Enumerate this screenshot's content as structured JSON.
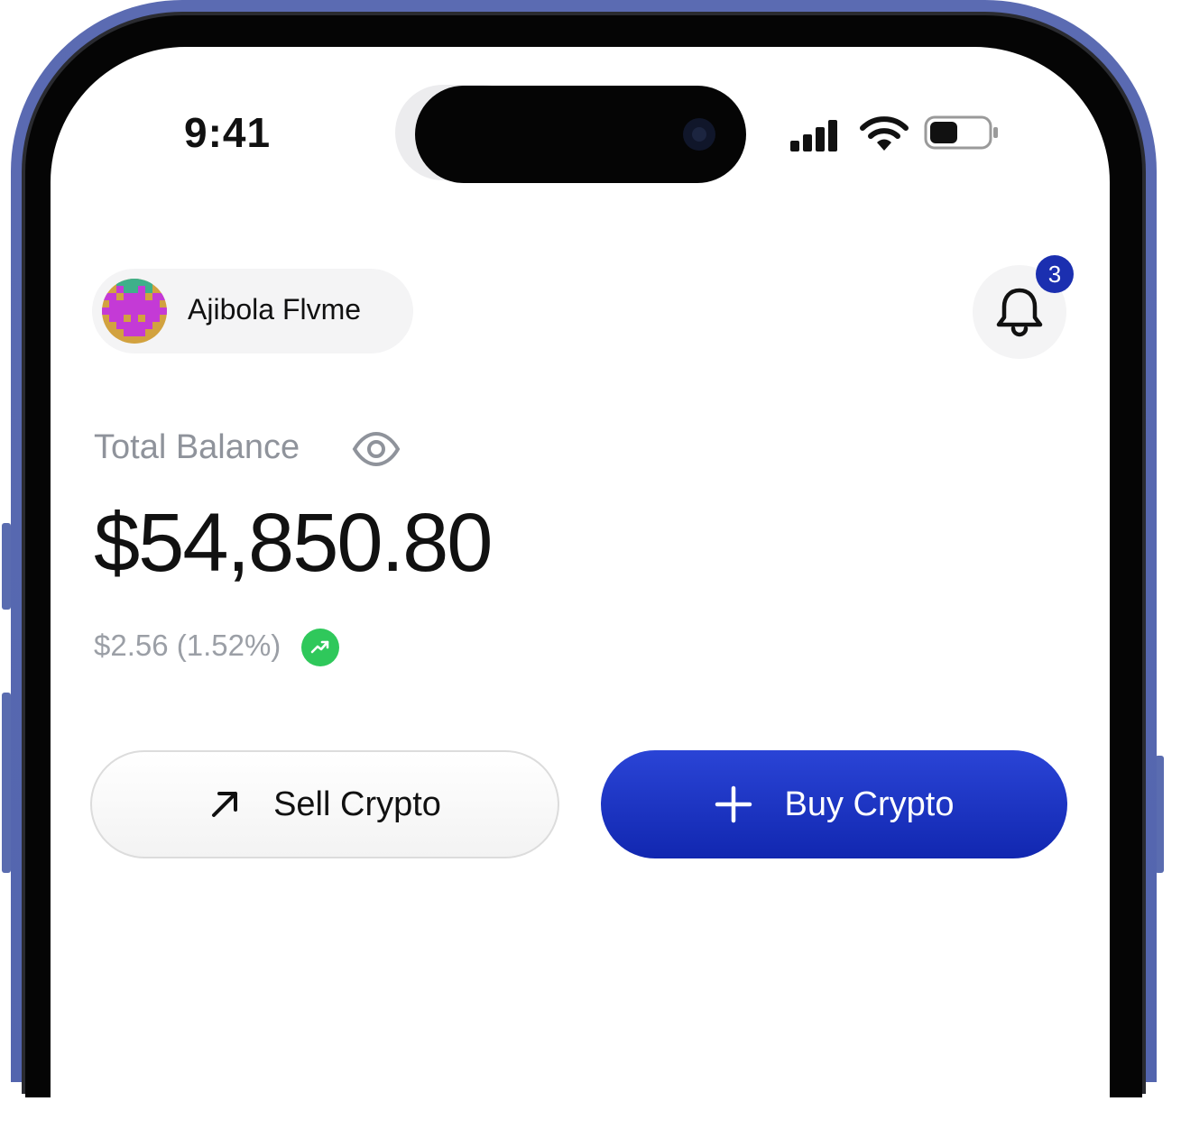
{
  "status_bar": {
    "time": "9:41",
    "icons": [
      "cellular-signal-icon",
      "wifi-icon",
      "battery-icon"
    ]
  },
  "header": {
    "user_name": "Ajibola Flvme",
    "notification_count": "3"
  },
  "balance": {
    "label": "Total Balance",
    "amount": "$54,850.80",
    "change": "$2.56 (1.52%)",
    "trend": "up"
  },
  "actions": {
    "sell_label": "Sell Crypto",
    "buy_label": "Buy Crypto"
  },
  "colors": {
    "accent": "#1b2fb0",
    "trend_up": "#2fc85b",
    "muted_text": "#8f939b",
    "phone_frame": "#5b6bb2"
  }
}
